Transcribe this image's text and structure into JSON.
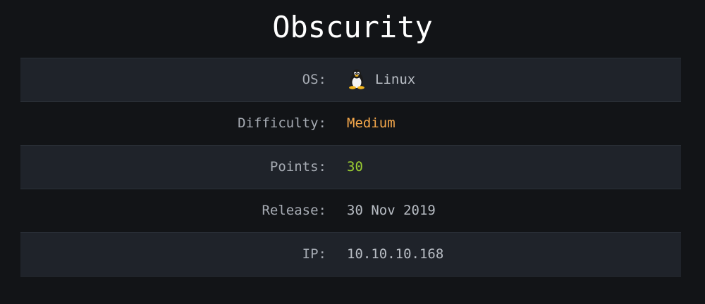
{
  "title": "Obscurity",
  "rows": [
    {
      "label": "OS:",
      "value": "Linux",
      "icon": "linux-penguin-icon"
    },
    {
      "label": "Difficulty:",
      "value": "Medium",
      "color": "#f5a84b"
    },
    {
      "label": "Points:",
      "value": "30",
      "color": "#9acd32"
    },
    {
      "label": "Release:",
      "value": "30 Nov 2019"
    },
    {
      "label": "IP:",
      "value": "10.10.10.168"
    }
  ]
}
